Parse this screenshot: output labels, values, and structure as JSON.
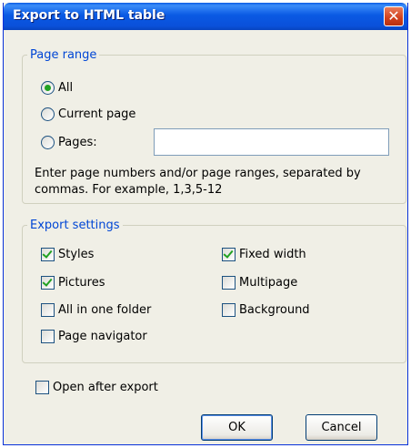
{
  "window": {
    "title": "Export to HTML table"
  },
  "page_range": {
    "legend": "Page range",
    "options": [
      {
        "label": "All",
        "selected": true
      },
      {
        "label": "Current page",
        "selected": false
      },
      {
        "label": "Pages:",
        "selected": false
      }
    ],
    "pages_input": {
      "value": "",
      "placeholder": ""
    },
    "hint": "Enter page numbers and/or page ranges, separated by commas. For example, 1,3,5-12"
  },
  "export_settings": {
    "legend": "Export settings",
    "styles": {
      "label": "Styles",
      "checked": true
    },
    "pictures": {
      "label": "Pictures",
      "checked": true
    },
    "all_in_one_folder": {
      "label": "All in one folder",
      "checked": false
    },
    "page_navigator": {
      "label": "Page navigator",
      "checked": false
    },
    "fixed_width": {
      "label": "Fixed width",
      "checked": true
    },
    "multipage": {
      "label": "Multipage",
      "checked": false
    },
    "background": {
      "label": "Background",
      "checked": false
    }
  },
  "open_after_export": {
    "label": "Open after export",
    "checked": false
  },
  "buttons": {
    "ok": "OK",
    "cancel": "Cancel"
  },
  "colors": {
    "title_bar": "#0a5ae4",
    "legend_text": "#0046d5",
    "checkmark": "#21a121",
    "dialog_bg": "#f0efe6"
  },
  "icons": {
    "close": "close-icon"
  }
}
